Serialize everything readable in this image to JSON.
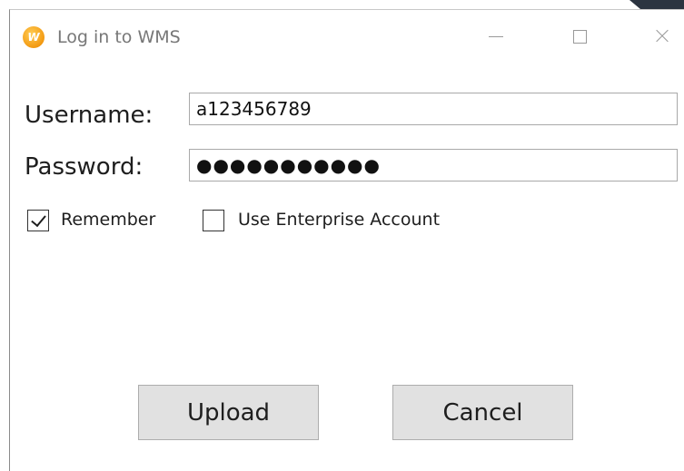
{
  "window": {
    "title": "Log in to WMS",
    "app_icon_letter": "W",
    "controls": [
      "minimize-icon",
      "maximize-icon",
      "close-icon"
    ]
  },
  "form": {
    "username_label": "Username:",
    "username_value": "a123456789",
    "password_label": "Password:",
    "password_value": "●●●●●●●●●●●",
    "remember_label": "Remember",
    "remember_checked": true,
    "enterprise_label": "Use Enterprise Account",
    "enterprise_checked": false
  },
  "buttons": {
    "upload_label": "Upload",
    "cancel_label": "Cancel"
  },
  "colors": {
    "accent_icon": "#f39a12",
    "button_bg": "#e1e1e1"
  }
}
